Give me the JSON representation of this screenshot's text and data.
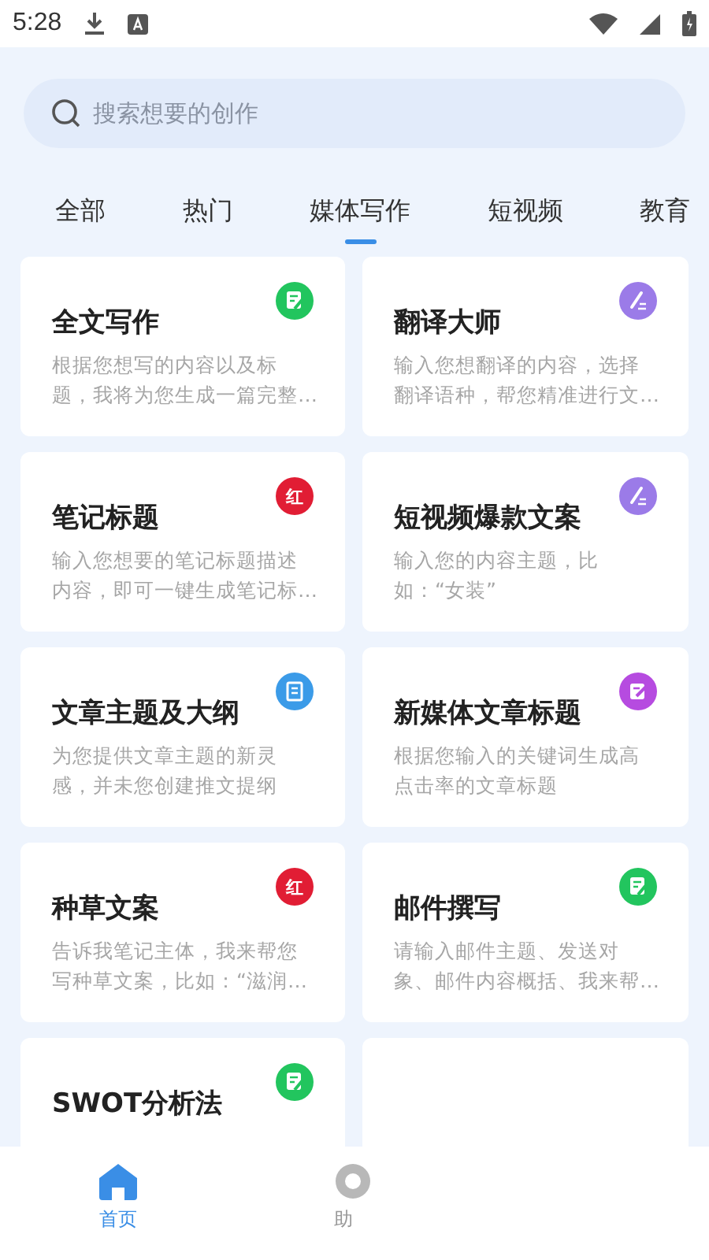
{
  "status_bar": {
    "time": "5:28"
  },
  "search": {
    "placeholder": "搜索想要的创作"
  },
  "tabs": [
    {
      "label": "全部",
      "selected": false
    },
    {
      "label": "热门",
      "selected": false
    },
    {
      "label": "媒体写作",
      "selected": true
    },
    {
      "label": "短视频",
      "selected": false
    },
    {
      "label": "教育",
      "selected": false
    }
  ],
  "cards": [
    {
      "title": "全文写作",
      "description_lines": [
        "根据您想写的内容以及标",
        "题，我将为您生成一篇完整…"
      ],
      "icon": {
        "kind": "note",
        "color": "#22c55e"
      }
    },
    {
      "title": "翻译大师",
      "description_lines": [
        "输入您想翻译的内容，选择",
        "翻译语种，帮您精准进行文…"
      ],
      "icon": {
        "kind": "pen",
        "color": "#9b7be8"
      }
    },
    {
      "title": "笔记标题",
      "description_lines": [
        "输入您想要的笔记标题描述",
        "内容，即可一键生成笔记标…"
      ],
      "icon": {
        "kind": "text",
        "color": "#e11d34",
        "text": "红"
      }
    },
    {
      "title": "短视频爆款文案",
      "description_lines": [
        "输入您的内容主题，比",
        "如：“女装”"
      ],
      "icon": {
        "kind": "pen",
        "color": "#9b7be8"
      }
    },
    {
      "title": "文章主题及大纲",
      "description_lines": [
        "为您提供文章主题的新灵",
        "感，并未您创建推文提纲"
      ],
      "icon": {
        "kind": "doc",
        "color": "#3b9be8"
      }
    },
    {
      "title": "新媒体文章标题",
      "description_lines": [
        "根据您输入的关键词生成高",
        "点击率的文章标题"
      ],
      "icon": {
        "kind": "edit",
        "color": "#b64be0"
      }
    },
    {
      "title": "种草文案",
      "description_lines": [
        "告诉我笔记主体，我来帮您",
        "写种草文案，比如：“滋润…"
      ],
      "icon": {
        "kind": "text",
        "color": "#e11d34",
        "text": "红"
      }
    },
    {
      "title": "邮件撰写",
      "description_lines": [
        "请输入邮件主题、发送对",
        "象、邮件内容概括、我来帮…"
      ],
      "icon": {
        "kind": "note",
        "color": "#22c55e"
      }
    },
    {
      "title": "SWOT分析法",
      "icon": {
        "kind": "note",
        "color": "#22c55e"
      }
    }
  ],
  "nav": [
    {
      "label": "首页",
      "selected": true,
      "kind": "home"
    },
    {
      "label": "助",
      "selected": false,
      "kind": "circle"
    }
  ]
}
